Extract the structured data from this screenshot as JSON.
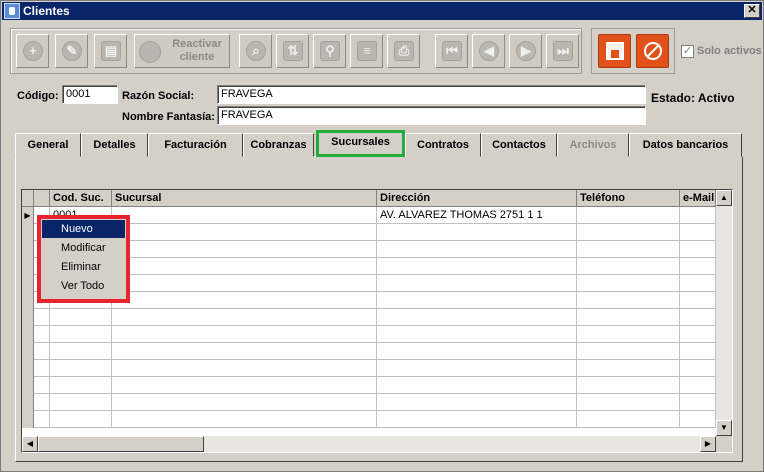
{
  "window": {
    "title": "Clientes",
    "close_label": "✕"
  },
  "toolbar": {
    "buttons": [
      {
        "name": "add",
        "glyph": "+"
      },
      {
        "name": "edit",
        "glyph": "✎"
      },
      {
        "name": "delete",
        "glyph": "▤"
      },
      {
        "name": "search",
        "glyph": "⌕"
      },
      {
        "name": "sort",
        "glyph": "⇅"
      },
      {
        "name": "filter",
        "glyph": "⚲"
      },
      {
        "name": "report",
        "glyph": "≡"
      },
      {
        "name": "print",
        "glyph": "⎙"
      },
      {
        "name": "first",
        "glyph": "⏮"
      },
      {
        "name": "prev",
        "glyph": "◀"
      },
      {
        "name": "next",
        "glyph": "▶"
      },
      {
        "name": "last",
        "glyph": "⏭"
      }
    ],
    "reactivar_line1": "Reactivar",
    "reactivar_line2": "cliente",
    "solo_activos_label": "Solo activos",
    "solo_activos_checked": true
  },
  "form": {
    "codigo_label": "Código:",
    "codigo_value": "0001",
    "razon_social_label": "Razón Social:",
    "razon_social_value": "FRAVEGA",
    "nombre_fantasia_label": "Nombre Fantasía:",
    "nombre_fantasia_value": "FRAVEGA",
    "estado_text": "Estado: Activo"
  },
  "tabs": [
    {
      "label": "General"
    },
    {
      "label": "Detalles"
    },
    {
      "label": "Facturación"
    },
    {
      "label": "Cobranzas"
    },
    {
      "label": "Sucursales",
      "active": true
    },
    {
      "label": "Contratos"
    },
    {
      "label": "Contactos"
    },
    {
      "label": "Archivos",
      "disabled": true
    },
    {
      "label": "Datos bancarios"
    }
  ],
  "grid": {
    "columns": [
      "Cod. Suc.",
      "Sucursal",
      "Dirección",
      "Teléfono",
      "e-Mail"
    ],
    "rows": [
      [
        "0001",
        "",
        "AV. ALVAREZ THOMAS 2751 1 1",
        "",
        ""
      ]
    ],
    "row_indicator": "▶",
    "empty_rows": 12
  },
  "context_menu": {
    "items": [
      {
        "label": "Nuevo",
        "highlighted": true
      },
      {
        "label": "Modificar"
      },
      {
        "label": "Eliminar"
      },
      {
        "label": "Ver Todo"
      }
    ]
  },
  "colors": {
    "title_bar": "#0a246a",
    "accent_orange": "#e1521b",
    "active_tab_outline": "#1fad3c",
    "menu_outline": "#e8242f"
  }
}
